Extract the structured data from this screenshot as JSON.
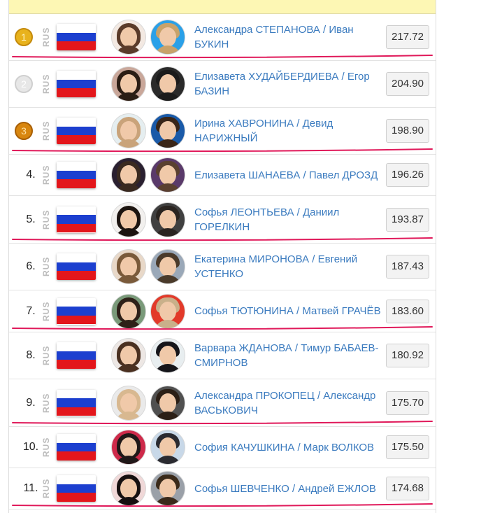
{
  "colors": {
    "header_bg": "#fdf7b4",
    "name_link": "#3b7bbf",
    "underline": "#e0195a",
    "flag_white": "#ffffff",
    "flag_blue": "#1c3fcf",
    "flag_red": "#e3161b"
  },
  "rows": [
    {
      "rank": "1",
      "medal": "gold",
      "country": "RUS",
      "names": "Александра СТЕПАНОВА / Иван БУКИН",
      "score": "217.72",
      "underlined": true
    },
    {
      "rank": "2",
      "medal": "silver",
      "country": "RUS",
      "names": "Елизавета ХУДАЙБЕРДИЕВА / Егор БАЗИН",
      "score": "204.90",
      "underlined": false
    },
    {
      "rank": "3",
      "medal": "bronze",
      "country": "RUS",
      "names": "Ирина ХАВРОНИНА / Девид НАРИЖНЫЙ",
      "score": "198.90",
      "underlined": true
    },
    {
      "rank": "4.",
      "medal": "",
      "country": "RUS",
      "names": "Елизавета ШАНАЕВА / Павел ДРОЗД",
      "score": "196.26",
      "underlined": false
    },
    {
      "rank": "5.",
      "medal": "",
      "country": "RUS",
      "names": "Софья ЛЕОНТЬЕВА / Даниил ГОРЕЛКИН",
      "score": "193.87",
      "underlined": true
    },
    {
      "rank": "6.",
      "medal": "",
      "country": "RUS",
      "names": "Екатерина МИРОНОВА / Евгений УСТЕНКО",
      "score": "187.43",
      "underlined": false
    },
    {
      "rank": "7.",
      "medal": "",
      "country": "RUS",
      "names": "Софья ТЮТЮНИНА / Матвей ГРАЧЁВ",
      "score": "183.60",
      "underlined": true
    },
    {
      "rank": "8.",
      "medal": "",
      "country": "RUS",
      "names": "Варвара ЖДАНОВА / Тимур БАБАЕВ-СМИРНОВ",
      "score": "180.92",
      "underlined": false
    },
    {
      "rank": "9.",
      "medal": "",
      "country": "RUS",
      "names": "Александра ПРОКОПЕЦ / Александр ВАСЬКОВИЧ",
      "score": "175.70",
      "underlined": true
    },
    {
      "rank": "10.",
      "medal": "",
      "country": "RUS",
      "names": "София КАЧУШКИНА / Марк ВОЛКОВ",
      "score": "175.50",
      "underlined": false
    },
    {
      "rank": "11.",
      "medal": "",
      "country": "RUS",
      "names": "Софья ШЕВЧЕНКО / Андрей ЕЖЛОВ",
      "score": "174.68",
      "underlined": true
    }
  ]
}
